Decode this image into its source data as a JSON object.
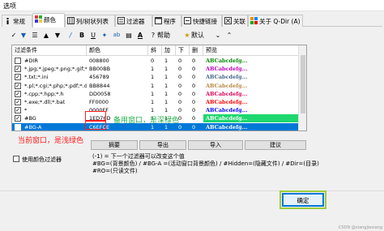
{
  "window": {
    "title": "选项"
  },
  "tabs": [
    {
      "label": "常规",
      "icon": "info-icon"
    },
    {
      "label": "颜色",
      "icon": "palette-icon"
    },
    {
      "label": "列/树状列表",
      "icon": "columns-icon"
    },
    {
      "label": "过滤器",
      "icon": "filter-icon"
    },
    {
      "label": "程序",
      "icon": "program-icon"
    },
    {
      "label": "快捷链接",
      "icon": "link-icon"
    },
    {
      "label": "关联",
      "icon": "association-icon"
    },
    {
      "label": "关于 Q-Dir (A)",
      "icon": "qdir-icon"
    }
  ],
  "toolbar": {
    "help_label": "帮助",
    "default_label": "默认",
    "items": [
      "up-icon",
      "down-icon",
      "list-icon",
      "bold-icon",
      "italic-icon",
      "underline-icon",
      "strike-icon",
      "abc-icon",
      "color-icon",
      "underline-ab-icon"
    ]
  },
  "grid": {
    "headers": [
      "过滤条件",
      "颜色",
      "斜",
      "加",
      "下",
      "删",
      "预览"
    ],
    "rows": [
      {
        "checked": false,
        "filter": "#DIR",
        "color": "008800",
        "i": "0",
        "b": "1",
        "u": "0",
        "s": "0",
        "preview": "ABCabcdefg...",
        "preview_color": "#008800"
      },
      {
        "checked": true,
        "filter": "*.jpg;*.jpeg;*.png;*.gif;*.b...",
        "color": "BB00BB",
        "i": "1",
        "b": "1",
        "u": "0",
        "s": "0",
        "preview": "ABCabcdefg...",
        "preview_color": "#bb00bb"
      },
      {
        "checked": true,
        "filter": "*.txt;*.ini",
        "color": "456789",
        "i": "1",
        "b": "1",
        "u": "0",
        "s": "0",
        "preview": "ABCabcdefg...",
        "preview_color": "#456789"
      },
      {
        "checked": true,
        "filter": "*.pl;*.cgi;*.php;*.pdf;*.doc...",
        "color": "BB8844",
        "i": "1",
        "b": "1",
        "u": "0",
        "s": "0",
        "preview": "ABCabcdefg...",
        "preview_color": "#bb8844"
      },
      {
        "checked": true,
        "filter": "*.cpp;*.hpp;*.h",
        "color": "DD0058",
        "i": "1",
        "b": "1",
        "u": "0",
        "s": "0",
        "preview": "ABCabcdefg...",
        "preview_color": "#dd0058"
      },
      {
        "checked": true,
        "filter": "*.exe;*.dll;*.bat",
        "color": "FF0000",
        "i": "1",
        "b": "1",
        "u": "0",
        "s": "0",
        "preview": "ABCabcdefg...",
        "preview_color": "#ff0000"
      },
      {
        "checked": true,
        "filter": "*",
        "color": "0000FF",
        "i": "1",
        "b": "1",
        "u": "0",
        "s": "0",
        "preview": "ABCabcdefg...",
        "preview_color": "#0000ff"
      },
      {
        "checked": true,
        "filter": "#BG",
        "color": "1ED76D",
        "i": "1",
        "b": "1",
        "u": "0",
        "s": "0",
        "preview": "ABCabcdefg...",
        "preview_color": "#ffffff",
        "preview_bg": "#1ed76d"
      },
      {
        "checked": true,
        "filter": "#BG-A",
        "color": "C6EFCE",
        "i": "1",
        "b": "1",
        "u": "0",
        "s": "0",
        "preview": "ABCabcdefg...",
        "preview_color": "#ffffff",
        "preview_bg": "#0078d7",
        "selected": true
      }
    ]
  },
  "annotations": {
    "standby": "备用窗口，是深绿色",
    "current": "当前窗口，是浅绿色"
  },
  "buttons": {
    "replace": "摘要",
    "export": "导出",
    "import": "导入",
    "suggest": "建议",
    "ok": "确定"
  },
  "use_filter_label": "使用颜色过滤器",
  "help_lines": [
    "(-1) = 下一个过滤器可以改变这个值",
    "#BG=(背景颜色) / #BG-A =(活动窗口背景颜色) / #Hidden=(隐藏文件) / #Dir=(目录)",
    "#RO=(只读文件)"
  ],
  "watermark": "CSDN @xiangjiexiang"
}
